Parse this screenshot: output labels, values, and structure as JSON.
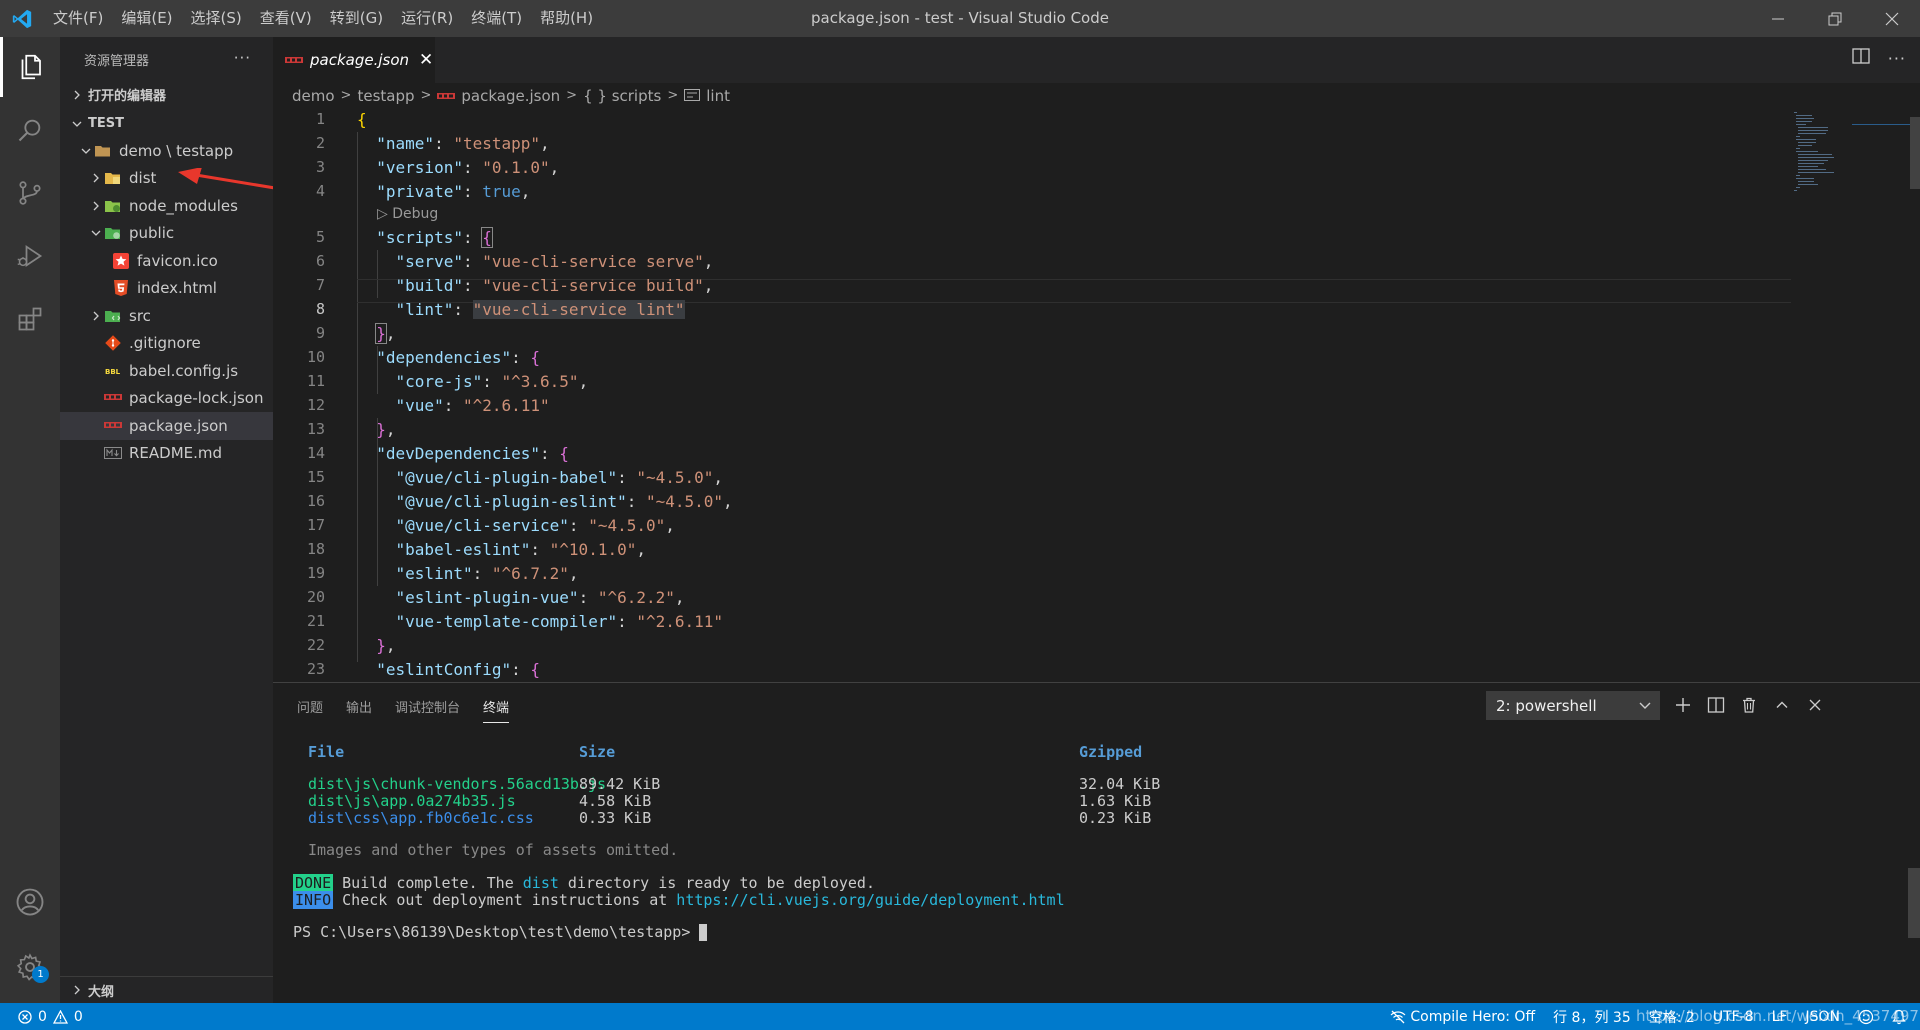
{
  "titlebar": {
    "menus": [
      "文件(F)",
      "编辑(E)",
      "选择(S)",
      "查看(V)",
      "转到(G)",
      "运行(R)",
      "终端(T)",
      "帮助(H)"
    ],
    "window_title": "package.json - test - Visual Studio Code"
  },
  "activitybar": {
    "items": [
      "files-icon",
      "search-icon",
      "source-control-icon",
      "run-debug-icon",
      "extensions-icon"
    ],
    "bottom": [
      "account-icon",
      "settings-gear-icon"
    ],
    "settings_badge": "1"
  },
  "sidebar": {
    "title": "资源管理器",
    "more": "···",
    "open_editors": "打开的编辑器",
    "workspace": "TEST",
    "root_folder": "demo \\ testapp",
    "items": [
      {
        "label": "dist",
        "kind": "folder",
        "expanded": false,
        "depth": 1
      },
      {
        "label": "node_modules",
        "kind": "folder",
        "expanded": false,
        "depth": 1
      },
      {
        "label": "public",
        "kind": "folder",
        "expanded": true,
        "depth": 1
      },
      {
        "label": "favicon.ico",
        "kind": "file",
        "depth": 2
      },
      {
        "label": "index.html",
        "kind": "file",
        "depth": 2
      },
      {
        "label": "src",
        "kind": "folder",
        "expanded": false,
        "depth": 1
      },
      {
        "label": ".gitignore",
        "kind": "file",
        "depth": 1
      },
      {
        "label": "babel.config.js",
        "kind": "file",
        "depth": 1
      },
      {
        "label": "package-lock.json",
        "kind": "file",
        "depth": 1
      },
      {
        "label": "package.json",
        "kind": "file",
        "depth": 1,
        "selected": true
      },
      {
        "label": "README.md",
        "kind": "file",
        "depth": 1
      }
    ],
    "outline": "大纲"
  },
  "editor": {
    "tab_label": "package.json",
    "tab_close": "✕",
    "breadcrumb": [
      "demo",
      "testapp",
      "package.json",
      "{ } scripts",
      "lint"
    ],
    "codelens": "▷ Debug",
    "line_numbers": [
      "1",
      "2",
      "3",
      "4",
      "5",
      "6",
      "7",
      "8",
      "9",
      "10",
      "11",
      "12",
      "13",
      "14",
      "15",
      "16",
      "17",
      "18",
      "19",
      "20",
      "21",
      "22",
      "23"
    ]
  },
  "panel": {
    "tabs": [
      "问题",
      "输出",
      "调试控制台",
      "终端"
    ],
    "active_tab": "终端",
    "terminal_select": "2: powershell",
    "terminal": {
      "headers": {
        "file": "File",
        "size": "Size",
        "gzipped": "Gzipped"
      },
      "rows": [
        {
          "file": "dist\\js\\chunk-vendors.56acd13b.js",
          "size": "89.42 KiB",
          "gzipped": "32.04 KiB"
        },
        {
          "file": "dist\\js\\app.0a274b35.js",
          "size": "4.58 KiB",
          "gzipped": "1.63 KiB"
        },
        {
          "file": "dist\\css\\app.fb0c6e1c.css",
          "size": "0.33 KiB",
          "gzipped": "0.23 KiB"
        }
      ],
      "omitted": "Images and other types of assets omitted.",
      "done_tag": "DONE",
      "done_pre": " Build complete. The ",
      "done_dist": "dist",
      "done_post": " directory is ready to be deployed.",
      "info_tag": "INFO",
      "info_pre": " Check out deployment instructions at ",
      "info_url": "https://cli.vuejs.org/guide/deployment.html",
      "prompt": "PS C:\\Users\\86139\\Desktop\\test\\demo\\testapp> "
    }
  },
  "statusbar": {
    "errors": "0",
    "warnings": "0",
    "compile_hero": "Compile Hero: Off",
    "position": "行 8，列 35",
    "spaces": "空格: 2",
    "encoding": "UTF-8",
    "eol": "LF",
    "language": "JSON",
    "watermark": "https://blog.csdn.net/weixin_45374972"
  },
  "colors": {
    "accent": "#007acc",
    "titlebar": "#3c3c3c",
    "sidebar": "#252526",
    "editor": "#1e1e1e",
    "annotation_arrow": "#e8372c"
  }
}
